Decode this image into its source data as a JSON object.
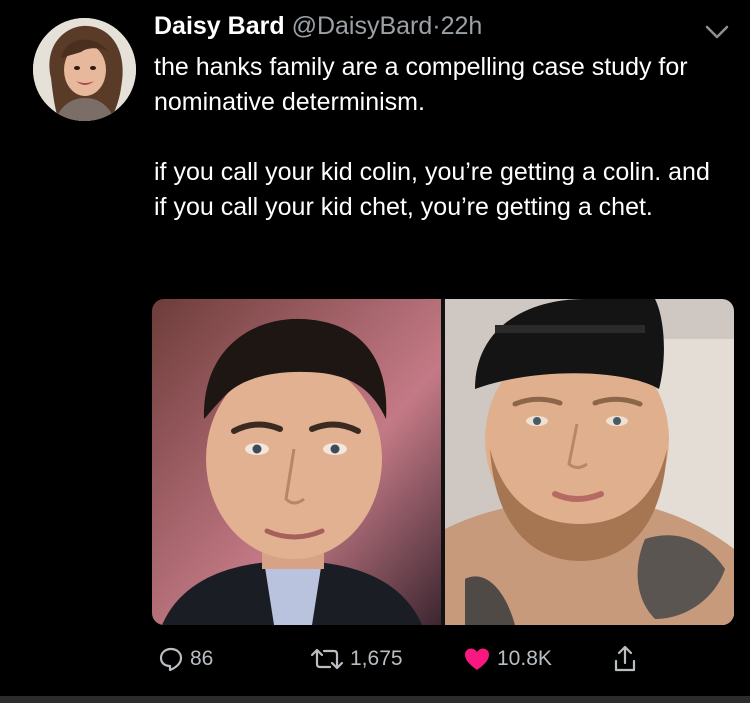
{
  "tweet": {
    "display_name": "Daisy Bard",
    "handle": "@DaisyBard",
    "separator": "·",
    "timestamp": "22h",
    "text_paragraph_1": "the hanks family are a compelling case study for nominative determinism.",
    "text_paragraph_2": "if you call your kid colin, you’re getting a colin. and if you call your kid chet, you’re getting a chet."
  },
  "actions": {
    "reply_count": "86",
    "retweet_count": "1,675",
    "like_count": "10.8K"
  },
  "icons": {
    "reply": "reply-icon",
    "retweet": "retweet-icon",
    "like": "heart-icon",
    "share": "share-icon",
    "more": "chevron-down-icon"
  },
  "colors": {
    "background": "#000000",
    "text": "#ffffff",
    "secondary_text": "#9aa1a7",
    "like": "#f91880",
    "action_icon": "#b9bec2"
  }
}
